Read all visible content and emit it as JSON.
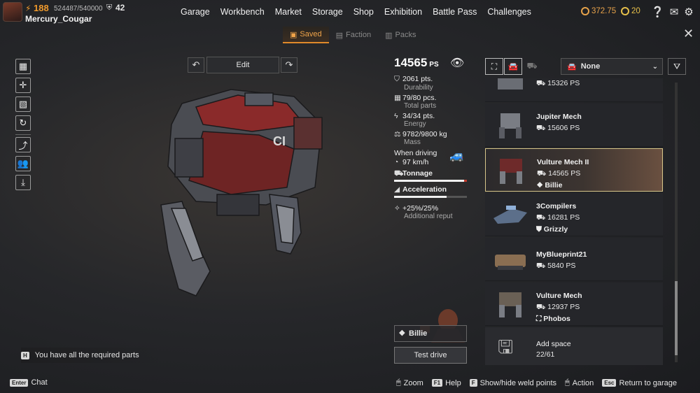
{
  "player": {
    "level": "188",
    "xp": "524487/540000",
    "rank": "42",
    "username": "Mercury_Cougar"
  },
  "nav": [
    "Garage",
    "Workbench",
    "Market",
    "Storage",
    "Shop",
    "Exhibition",
    "Battle Pass",
    "Challenges"
  ],
  "currency": {
    "coins": "372.75",
    "other": "20"
  },
  "subtabs": {
    "saved": "Saved",
    "faction": "Faction",
    "packs": "Packs"
  },
  "edit_label": "Edit",
  "stats": {
    "ps": "14565",
    "ps_unit": "PS",
    "durability_value": "2061 pts.",
    "durability_label": "Durability",
    "parts_value": "79/80 pcs.",
    "parts_label": "Total parts",
    "energy_value": "34/34 pts.",
    "energy_label": "Energy",
    "mass_value": "9782/9800 kg",
    "mass_label": "Mass",
    "driving_label": "When driving",
    "speed": "97 km/h",
    "tonnage_label": "Tonnage",
    "acceleration_label": "Acceleration",
    "reputation_value": "+25%/25%",
    "reputation_label": "Additional reput"
  },
  "filter": {
    "dropdown_value": "None"
  },
  "list": [
    {
      "name": "",
      "ps": "15326 PS",
      "faction": ""
    },
    {
      "name": "Jupiter Mech",
      "ps": "15606 PS",
      "faction": ""
    },
    {
      "name": "Vulture Mech II",
      "ps": "14565 PS",
      "faction": "Billie"
    },
    {
      "name": "3Compilers",
      "ps": "16281 PS",
      "faction": "Grizzly"
    },
    {
      "name": "MyBlueprint21",
      "ps": "5840 PS",
      "faction": ""
    },
    {
      "name": "Vulture Mech",
      "ps": "12937 PS",
      "faction": "Phobos"
    }
  ],
  "add_space": {
    "label": "Add space",
    "count": "22/61"
  },
  "pilot_name": "Billie",
  "test_drive": "Test drive",
  "hint": {
    "key": "H",
    "text": "You have all the required parts"
  },
  "chat": {
    "key": "Enter",
    "label": "Chat"
  },
  "footer": {
    "zoom": "Zoom",
    "help_key": "F1",
    "help": "Help",
    "weld_key": "F",
    "weld": "Show/hide weld points",
    "action": "Action",
    "return_key": "Esc",
    "return": "Return to garage"
  },
  "colors": {
    "accent": "#e08a2a",
    "selected_border": "#d7c68a",
    "coin": "#e7a24a"
  }
}
